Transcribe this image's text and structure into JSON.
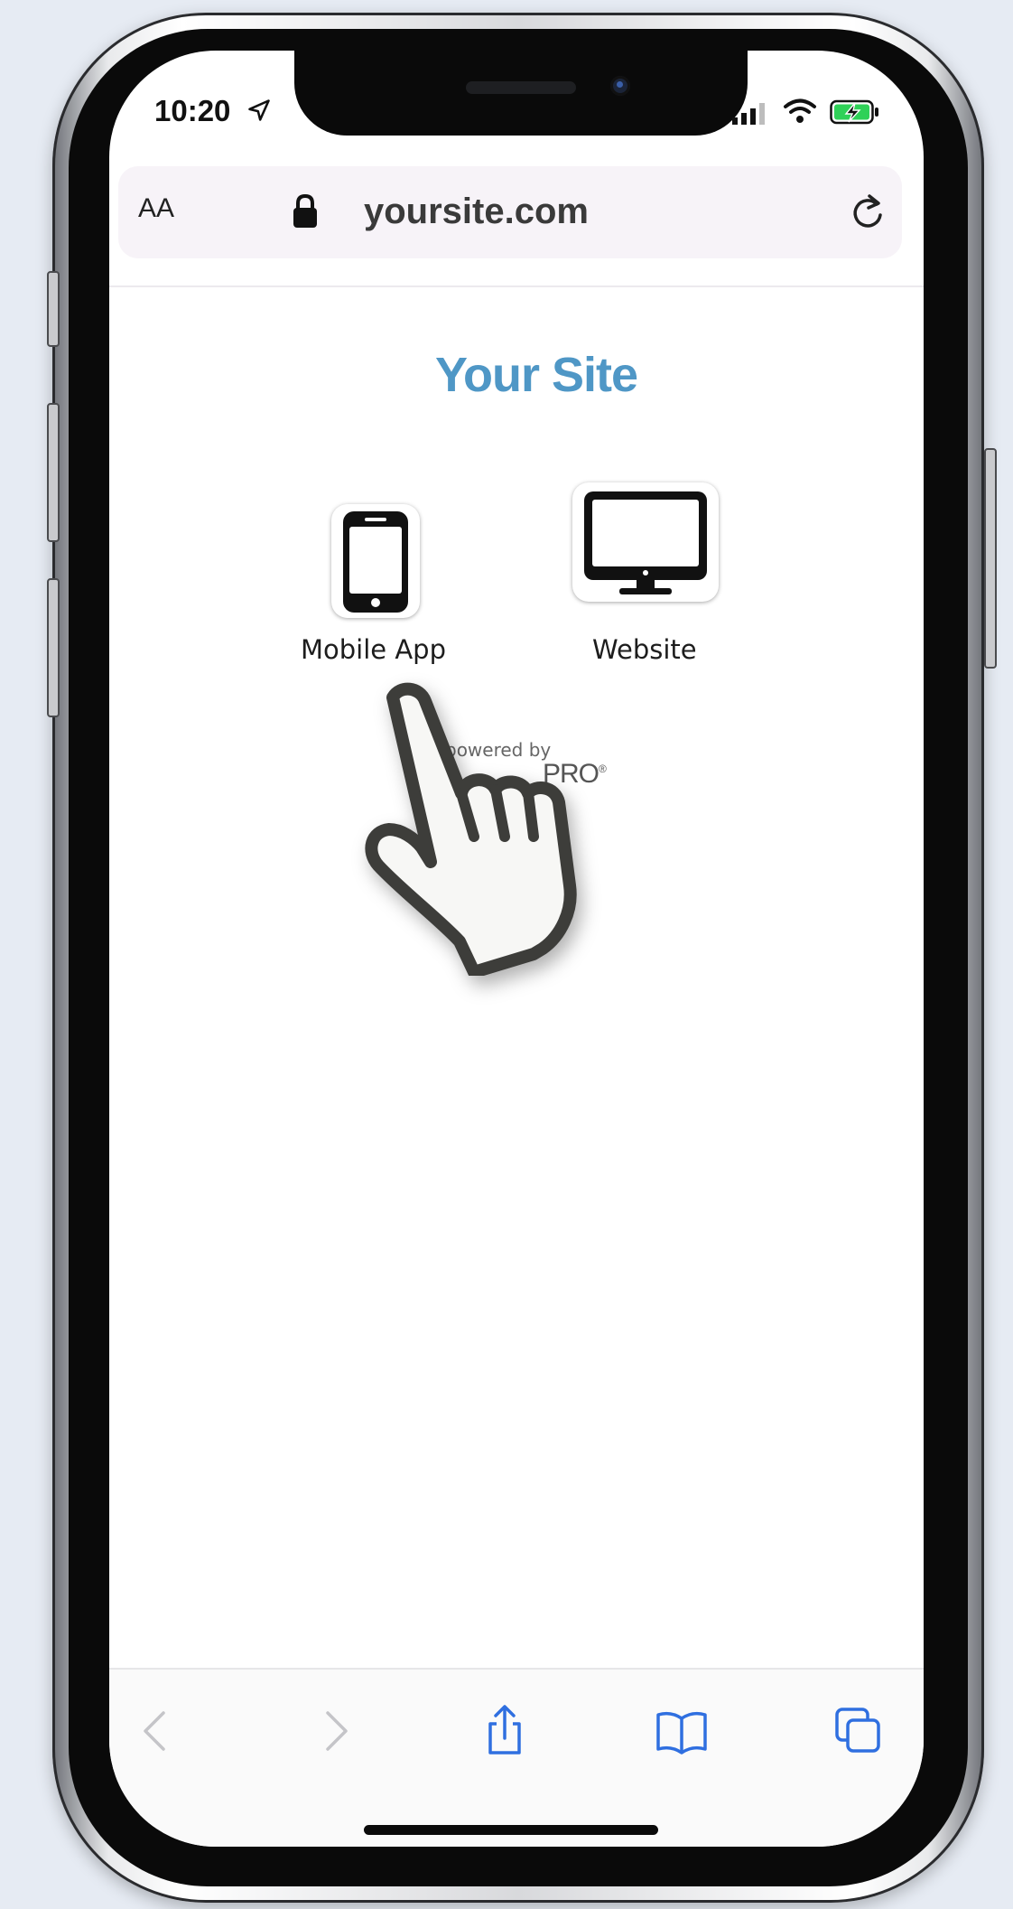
{
  "status_bar": {
    "time": "10:20",
    "icons": [
      "location-arrow-icon",
      "cellular-signal-icon",
      "wifi-icon",
      "battery-charging-icon"
    ]
  },
  "address_bar": {
    "text_size_label": "AA",
    "url": "yoursite.com",
    "lock_icon": "lock-icon",
    "reload_icon": "reload-icon"
  },
  "page": {
    "title": "Your Site",
    "tiles": [
      {
        "label": "Mobile App",
        "icon": "smartphone-icon"
      },
      {
        "label": "Website",
        "icon": "desktop-monitor-icon"
      }
    ],
    "powered_by": "powered by",
    "brand_partial": "PRO",
    "brand_mark": "®",
    "overlay_icon": "pointing-hand-cursor-icon"
  },
  "toolbar": {
    "items": [
      "back-icon",
      "forward-icon",
      "share-icon",
      "bookmarks-icon",
      "tabs-icon"
    ]
  },
  "colors": {
    "title": "#4f97c6",
    "toolbar_active": "#2f6fe0",
    "toolbar_disabled": "#c4c4c8",
    "address_bar_bg": "#f7f3f8",
    "battery_green": "#2fd158"
  }
}
